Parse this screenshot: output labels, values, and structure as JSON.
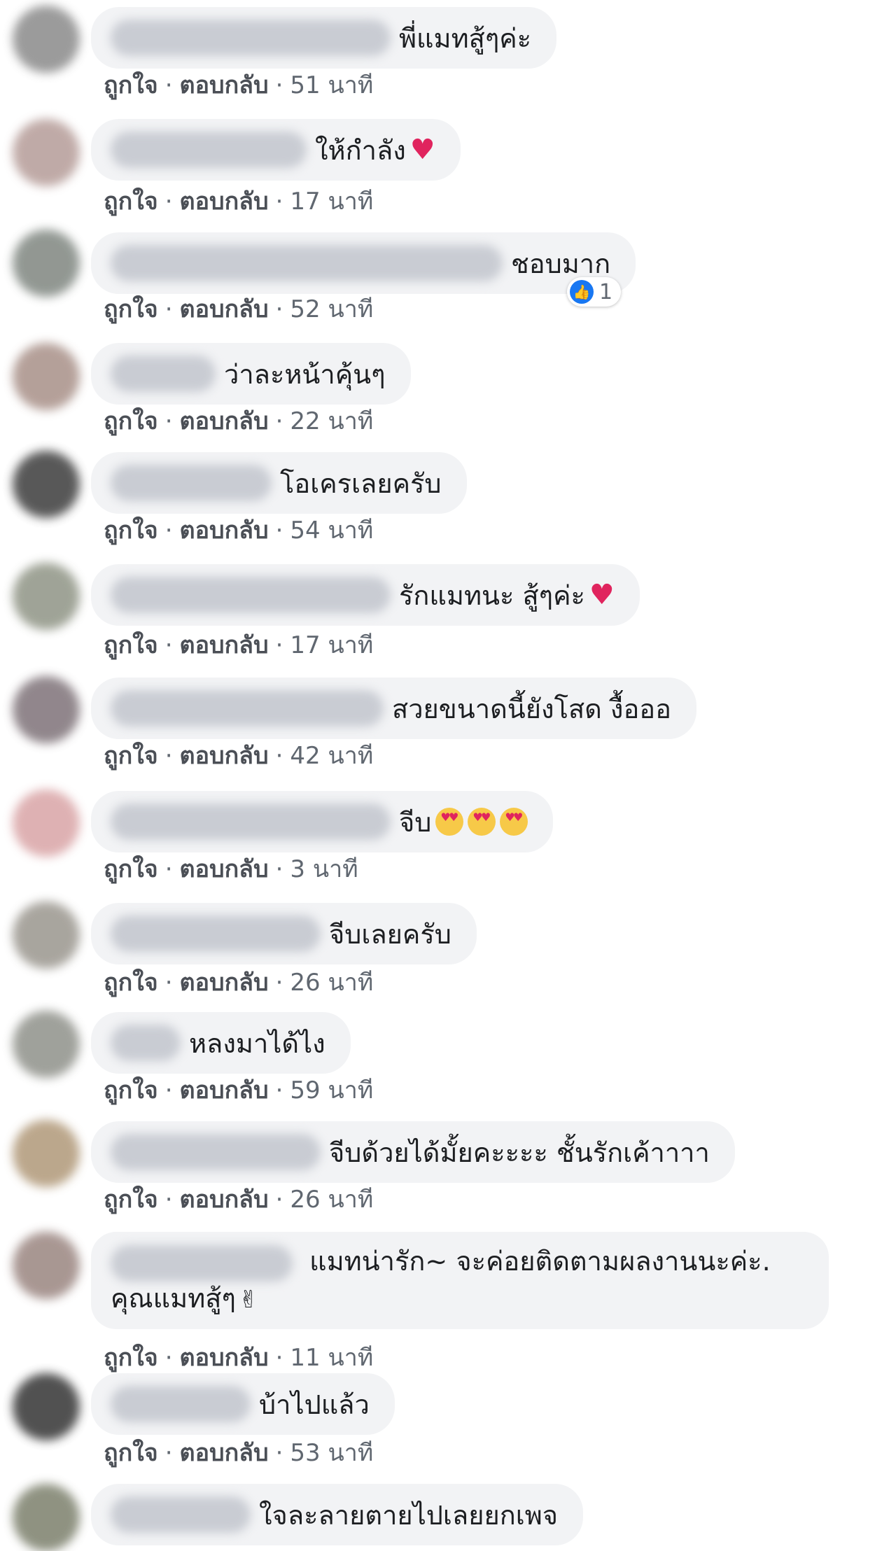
{
  "actions": {
    "like": "ถูกใจ",
    "reply": "ตอบกลับ",
    "separator": "·"
  },
  "comments": [
    {
      "text": "พี่แมทสู้ๆค่ะ",
      "time": "51 นาที"
    },
    {
      "text": "ให้กำลัง",
      "time": "17 นาที",
      "emoji": "heart"
    },
    {
      "text": "ชอบมาก",
      "time": "52 นาที",
      "likes": "1"
    },
    {
      "text": "ว่าละหน้าคุ้นๆ",
      "time": "22 นาที"
    },
    {
      "text": "โอเครเลยครับ",
      "time": "54 นาที"
    },
    {
      "text": "รักแมทนะ สู้ๆค่ะ",
      "time": "17 นาที",
      "emoji": "heart"
    },
    {
      "text": "สวยขนาดนี้ยังโสด งื้อออ",
      "time": "42 นาที"
    },
    {
      "text": "จีบ",
      "time": "3 นาที",
      "emoji": "heart-eyes-x3"
    },
    {
      "text": "จีบเลยครับ",
      "time": "26 นาที"
    },
    {
      "text": "หลงมาได้ไง",
      "time": "59 นาที"
    },
    {
      "text": "จีบด้วยได้มั้ยคะะะะ ชั้นรักเค้าาาา",
      "time": "26 นาที"
    },
    {
      "text": "แมทน่ารัก~ จะค่อยติดตามผลงานนะค่ะ. คุณแมทสู้ๆ",
      "time": "11 นาที",
      "emoji": "victory-hand"
    },
    {
      "text": "บ้าไปแล้ว",
      "time": "53 นาที"
    },
    {
      "text": "ใจละลายตายไปเลยยกเพจ",
      "time": ""
    }
  ],
  "colors": {
    "bubble": "#f2f3f5",
    "meta": "#4b4f56",
    "like_blue": "#1877f2",
    "heart": "#e0245e"
  }
}
